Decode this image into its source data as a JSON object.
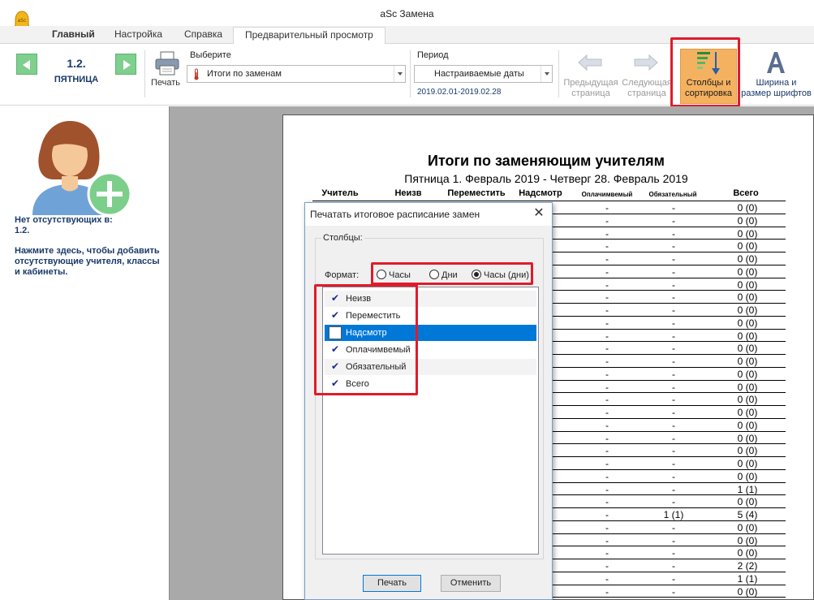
{
  "app": {
    "title": "aSc Замена"
  },
  "tabs": [
    {
      "label": "Главный"
    },
    {
      "label": "Настройка"
    },
    {
      "label": "Справка"
    },
    {
      "label": "Предварительный просмотр"
    }
  ],
  "ribbon": {
    "day_number": "1.2.",
    "day_name": "ПЯТНИЦА",
    "print_label": "Печать",
    "select_label": "Выберите",
    "select_value": "Итоги по заменам",
    "period_label": "Период",
    "period_value": "Настраиваемые даты",
    "period_dates": "2019.02.01-2019.02.28",
    "prev_page": [
      "Предыдущая",
      "страница"
    ],
    "next_page": [
      "Следующая",
      "страница"
    ],
    "columns_sort": [
      "Столбцы и",
      "сортировка"
    ],
    "width_font": [
      "Ширина и",
      "размер шрифтов"
    ]
  },
  "left_panel": {
    "absent_line1": "Нет отсутствующих в:",
    "absent_line2": "1.2.",
    "add_text": "Нажмите здесь, чтобы добавить отсутствующие учителя, классы и кабинеты."
  },
  "report": {
    "title": "Итоги по заменяющим учителям",
    "subtitle": "Пятница 1. Февраль 2019 - Четверг 28. Февраль 2019",
    "columns": [
      "Учитель",
      "Неизв",
      "Переместить",
      "Надсмотр",
      "Оплачимвемый",
      "Обязательный",
      "Всего"
    ],
    "rows": [
      [
        "-",
        "-",
        "0 (0)"
      ],
      [
        "-",
        "-",
        "0 (0)"
      ],
      [
        "-",
        "-",
        "0 (0)"
      ],
      [
        "-",
        "-",
        "0 (0)"
      ],
      [
        "-",
        "-",
        "0 (0)"
      ],
      [
        "-",
        "-",
        "0 (0)"
      ],
      [
        "-",
        "-",
        "0 (0)"
      ],
      [
        "-",
        "-",
        "0 (0)"
      ],
      [
        "-",
        "-",
        "0 (0)"
      ],
      [
        "-",
        "-",
        "0 (0)"
      ],
      [
        "-",
        "-",
        "0 (0)"
      ],
      [
        "-",
        "-",
        "0 (0)"
      ],
      [
        "-",
        "-",
        "0 (0)"
      ],
      [
        "-",
        "-",
        "0 (0)"
      ],
      [
        "-",
        "-",
        "0 (0)"
      ],
      [
        "-",
        "-",
        "0 (0)"
      ],
      [
        "-",
        "-",
        "0 (0)"
      ],
      [
        "-",
        "-",
        "0 (0)"
      ],
      [
        "-",
        "-",
        "0 (0)"
      ],
      [
        "-",
        "-",
        "0 (0)"
      ],
      [
        "-",
        "-",
        "0 (0)"
      ],
      [
        "-",
        "-",
        "0 (0)"
      ],
      [
        "-",
        "-",
        "1 (1)"
      ],
      [
        "-",
        "-",
        "0 (0)"
      ],
      [
        "-",
        "1 (1)",
        "5 (4)"
      ],
      [
        "-",
        "-",
        "0 (0)"
      ],
      [
        "-",
        "-",
        "0 (0)"
      ],
      [
        "-",
        "-",
        "0 (0)"
      ],
      [
        "-",
        "-",
        "2 (2)"
      ],
      [
        "-",
        "-",
        "1 (1)"
      ],
      [
        "-",
        "-",
        "0 (0)"
      ],
      [
        "-",
        "-",
        "0 (0)"
      ]
    ]
  },
  "dialog": {
    "title": "Печатать итоговое расписание замен",
    "columns_group": "Столбцы:",
    "format_label": "Формат:",
    "formats": [
      {
        "label": "Часы",
        "selected": false
      },
      {
        "label": "Дни",
        "selected": false
      },
      {
        "label": "Часы (дни)",
        "selected": true
      }
    ],
    "items": [
      {
        "label": "Неизв",
        "checked": true
      },
      {
        "label": "Переместить",
        "checked": true
      },
      {
        "label": "Надсмотр",
        "checked": false
      },
      {
        "label": "Оплачимвемый",
        "checked": true
      },
      {
        "label": "Обязательный",
        "checked": true
      },
      {
        "label": "Всего",
        "checked": true
      }
    ],
    "print_button": "Печать",
    "cancel_button": "Отменить"
  },
  "colors": {
    "highlight": "#e01b2a",
    "accent": "#f4b261",
    "selection": "#0078d7",
    "nav_green": "#7fcf8e"
  },
  "icons": [
    "bell-icon",
    "printer-icon",
    "thermometer-icon",
    "arrow-left-icon",
    "arrow-right-icon",
    "columns-sort-icon",
    "font-icon",
    "avatar-add-icon",
    "close-icon"
  ]
}
